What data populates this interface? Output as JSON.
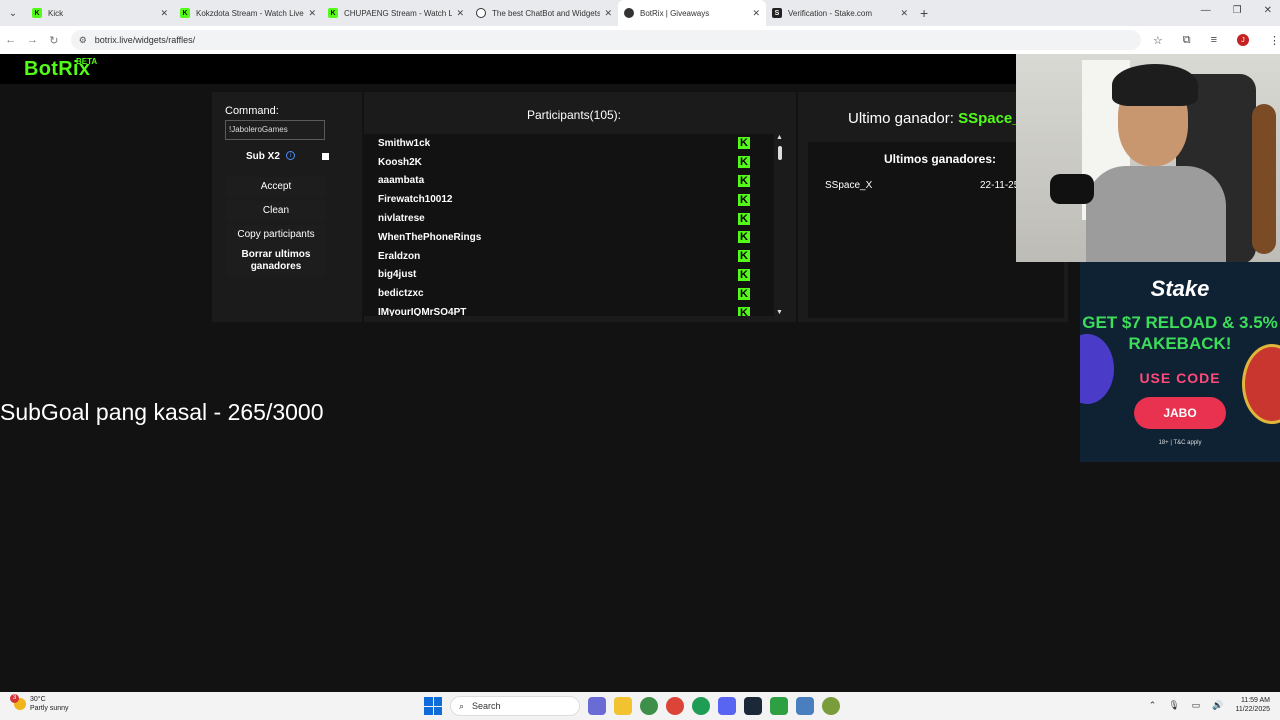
{
  "browser": {
    "tabs": [
      {
        "title": "Kick",
        "icon": "kick-icon",
        "active": false
      },
      {
        "title": "Kokzdota Stream - Watch Live o",
        "icon": "kick-icon",
        "active": false
      },
      {
        "title": "CHUPAENG Stream - Watch Live",
        "icon": "kick-icon",
        "active": false
      },
      {
        "title": "The best ChatBot and Widgets",
        "icon": "github-icon",
        "active": false
      },
      {
        "title": "BotRix | Giveaways",
        "icon": "botrix-icon",
        "active": true
      },
      {
        "title": "Verification - Stake.com",
        "icon": "stake-icon",
        "active": false
      }
    ],
    "new_tab": "+",
    "url": "botrix.live/widgets/raffles/",
    "profile_initial": "J"
  },
  "app": {
    "logo": "BotRix",
    "badge": "BETA",
    "accent": "#53fc18"
  },
  "controls": {
    "command_label": "Command:",
    "command_value": "!JaboleroGames",
    "sub_label": "Sub X2",
    "accept": "Accept",
    "clean": "Clean",
    "copy": "Copy participants",
    "clear_winners": "Borrar ultimos ganadores"
  },
  "participants": {
    "title": "Participants(105):",
    "list": [
      "Smithw1ck",
      "Koosh2K",
      "aaambata",
      "Firewatch10012",
      "nivlatrese",
      "WhenThePhoneRings",
      "Eraldzon",
      "big4just",
      "bedictzxc",
      "IMyourIQMrSO4PT"
    ]
  },
  "winners": {
    "last_label": "Ultimo ganador:",
    "last_name": "SSpace_X",
    "title": "Ultimos ganadores:",
    "rows": [
      {
        "name": "SSpace_X",
        "date": "22-11-25"
      }
    ]
  },
  "overlay": {
    "subgoal": "SubGoal pang kasal - 265/3000"
  },
  "ad": {
    "brand": "Stake",
    "headline": "GET $7 RELOAD & 3.5% RAKEBACK!",
    "use_code": "USE CODE",
    "code": "JABO",
    "terms": "18+ | T&C apply"
  },
  "taskbar": {
    "temp": "30°C",
    "weather": "Partly sunny",
    "search": "Search",
    "time": "11:59 AM",
    "date": "11/22/2025",
    "notif_count": "3"
  }
}
